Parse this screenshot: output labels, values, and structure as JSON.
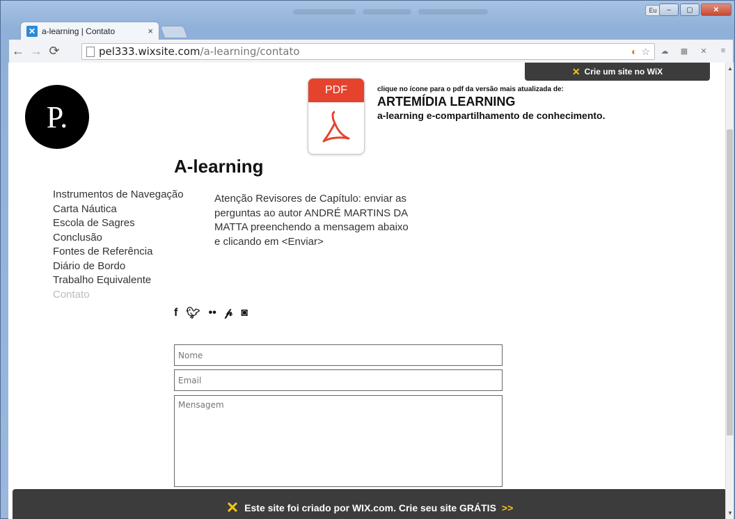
{
  "browser": {
    "tab_title": "a-learning | Contato",
    "tab_close": "×",
    "lang_button": "Eu",
    "minimize": "‒",
    "maximize": "▢",
    "close": "✕",
    "url_domain": "pel333.wixsite.com",
    "url_path": "/a-learning/contato"
  },
  "wix_top": {
    "label": "Crie um site no WiX"
  },
  "logo": {
    "text": "P."
  },
  "pdf": {
    "label": "PDF"
  },
  "promo": {
    "small": "clique no ícone para o pdf da versão mais atualizada de:",
    "title": "ARTEMÍDIA LEARNING",
    "subtitle": "a-learning e-compartilhamento de conhecimento."
  },
  "heading": "A-learning",
  "menu": [
    "Instrumentos de Navegação",
    "Carta Náutica",
    "Escola de Sagres",
    "Conclusão",
    "Fontes de Referência",
    "Diário de Bordo",
    "Trabalho Equivalente",
    "Contato"
  ],
  "menu_active": "Contato",
  "notice": "Atenção Revisores de Capítulo: enviar as perguntas ao autor ANDRÉ MARTINS DA MATTA preenchendo a mensagem abaixo e clicando em <Enviar>",
  "social_icons": [
    "facebook-icon",
    "twitter-icon",
    "flickr-icon",
    "pinterest-icon",
    "instagram-icon"
  ],
  "form": {
    "nome_placeholder": "Nome",
    "email_placeholder": "Email",
    "mensagem_placeholder": "Mensagem"
  },
  "wix_bottom": {
    "text": "Este site foi criado por WIX.com. Crie seu site GRÁTIS",
    "arrows": ">>"
  }
}
